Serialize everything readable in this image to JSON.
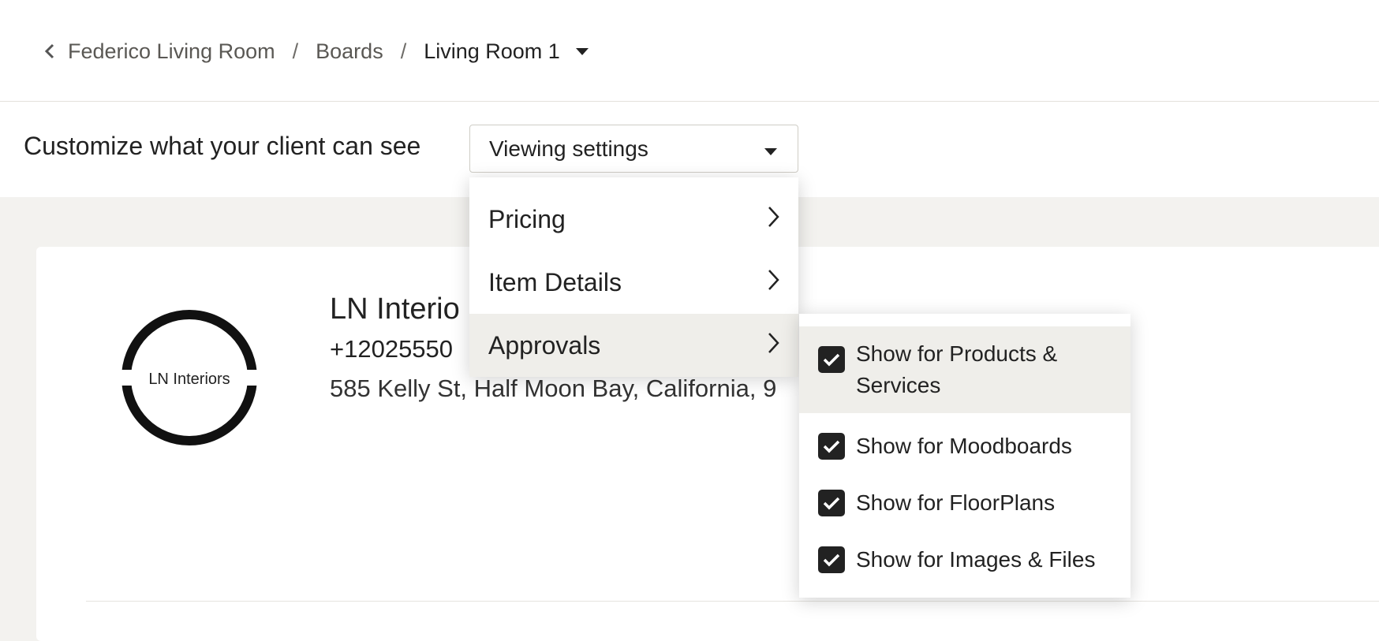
{
  "breadcrumb": {
    "project": "Federico Living Room",
    "section": "Boards",
    "current": "Living Room 1",
    "separator": "/"
  },
  "settings": {
    "label": "Customize what your client can see",
    "select_value": "Viewing settings"
  },
  "company": {
    "logo_text": "LN Interiors",
    "name": "LN Interio",
    "phone": "+12025550",
    "address": "585 Kelly St, Half Moon Bay, California, 9"
  },
  "menu": {
    "items": [
      {
        "label": "Pricing"
      },
      {
        "label": "Item Details"
      },
      {
        "label": "Approvals"
      }
    ]
  },
  "submenu": {
    "items": [
      {
        "label": "Show for Products & Services",
        "checked": true
      },
      {
        "label": "Show for Moodboards",
        "checked": true
      },
      {
        "label": "Show for FloorPlans",
        "checked": true
      },
      {
        "label": "Show for Images & Files",
        "checked": true
      }
    ]
  },
  "colors": {
    "highlight": "#efeeea",
    "background": "#f3f2ef",
    "text": "#222222",
    "checkbox": "#222222"
  }
}
